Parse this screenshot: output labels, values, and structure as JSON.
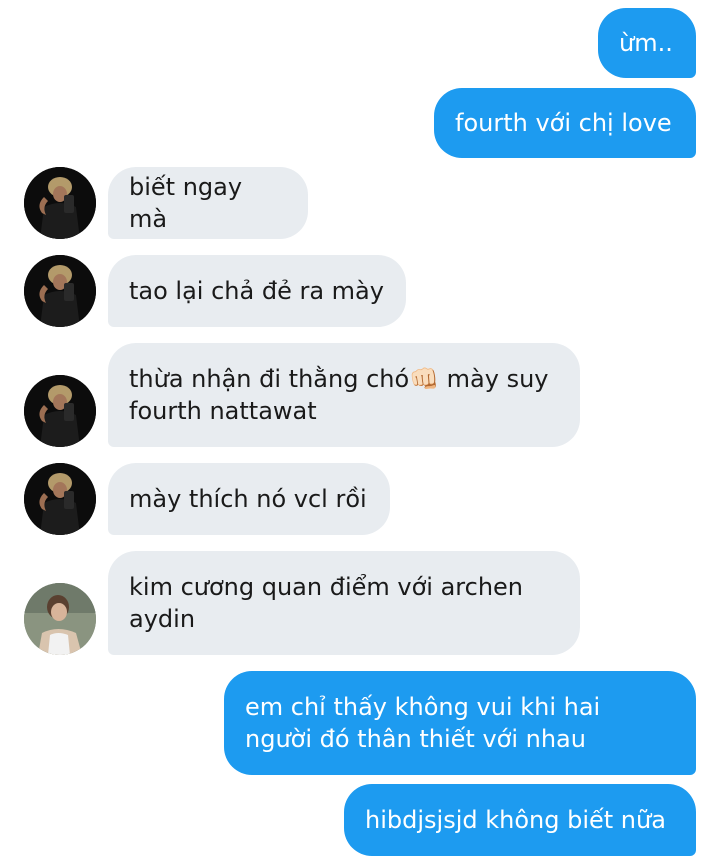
{
  "conversation": {
    "messages": [
      {
        "id": "m1",
        "direction": "outgoing",
        "text": "ừm.."
      },
      {
        "id": "m2",
        "direction": "outgoing",
        "text": "fourth với chị love"
      },
      {
        "id": "m3",
        "direction": "incoming",
        "avatar": "friend-avatar-curly",
        "text": "biết ngay mà"
      },
      {
        "id": "m4",
        "direction": "incoming",
        "avatar": "friend-avatar-curly",
        "text": "tao lại chả đẻ ra mày"
      },
      {
        "id": "m5",
        "direction": "incoming",
        "avatar": "friend-avatar-curly",
        "text": "thừa nhận đi thằng chó👊🏻 mày suy\nfourth nattawat"
      },
      {
        "id": "m6",
        "direction": "incoming",
        "avatar": "friend-avatar-curly",
        "text": "mày thích nó vcl rồi"
      },
      {
        "id": "m7",
        "direction": "incoming",
        "avatar": "friend-avatar-tanktop",
        "text": "kim cương quan điểm với archen\naydin"
      },
      {
        "id": "m8",
        "direction": "outgoing",
        "text": "em chỉ thấy không vui khi hai\nngười đó thân thiết với nhau"
      },
      {
        "id": "m9",
        "direction": "outgoing",
        "text": "hibdjsjsjd không biết nữa"
      }
    ]
  },
  "colors": {
    "outgoing_bubble": "#1d9bf0",
    "incoming_bubble": "#e8ecf0",
    "outgoing_text": "#ffffff",
    "incoming_text": "#1a1a1a"
  }
}
